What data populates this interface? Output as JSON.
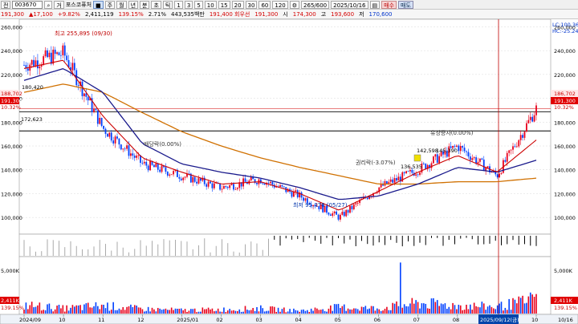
{
  "toolbar": {
    "code": "003670",
    "market_prefix": "전",
    "name_prefix": "거",
    "stock_name": "포스코퓨처",
    "period_buttons": [
      "주",
      "월",
      "년",
      "분",
      "초",
      "틱",
      "1",
      "3",
      "5",
      "10",
      "15",
      "20",
      "30",
      "60",
      "120"
    ],
    "range": "265/600",
    "date": "2025/10/16",
    "buy_label": "매수",
    "sell_label": "매도"
  },
  "quote": {
    "price": "191,300",
    "change": "17,100",
    "change_pct": "+9.82%",
    "volume": "2,411,119",
    "volume_ratio": "139.15%",
    "turnover": "2.71%",
    "amount": "443,535백만",
    "open_label": "시",
    "high_label": "고",
    "low_label": "저",
    "open_prefix_label": "191,400 회우선",
    "open": "191,300",
    "high": "174,300",
    "low_label_val": "193,600",
    "low": "170,600"
  },
  "price_axis": {
    "left_ticks": [
      "260,000",
      "240,000",
      "220,000",
      "200,000",
      "180,000",
      "160,000",
      "140,000",
      "120,000",
      "100,000"
    ],
    "right_ticks": [
      "260,000",
      "240,000",
      "220,000",
      "200,000",
      "180,000",
      "160,000",
      "140,000",
      "120,000",
      "100,000"
    ],
    "left_labels": {
      "current": "191,300",
      "pct": "10.32%",
      "hline1": "188,702",
      "hline2": "172,623"
    },
    "right_labels": {
      "current": "191,300",
      "pct": "10.32%",
      "hline1": "186,702",
      "lc": "LC:100.36",
      "hc": "HC:-25.24"
    }
  },
  "annotations": {
    "high": "최고 255,895 (09/30)",
    "low": "최저 95,476 (05/27)",
    "ex_rights": "권리락(-3.07%)",
    "rights_issue": "유상증자(0.00%)",
    "ex_div": "배당락(0.00%)",
    "price_a": "136,535",
    "price_b": "142,598",
    "price_c": "180,420",
    "price_d": "145,390"
  },
  "volume_axis": {
    "left_ticks": [
      "5,000K"
    ],
    "right_ticks": [
      "5,000K"
    ],
    "left_labels": {
      "current": "2,411K",
      "pct": "139.15%"
    },
    "right_labels": {
      "current": "2,411K",
      "pct": "139.15%"
    }
  },
  "date_axis": {
    "labels": [
      "2024/09",
      "10",
      "11",
      "12",
      "2025/01",
      "02",
      "03",
      "04",
      "05",
      "06",
      "07",
      "08",
      "09",
      "10"
    ],
    "cursor_label": "2025/09/12(금)",
    "right_label": "10/16"
  },
  "chart_data": {
    "type": "candlestick",
    "x": [
      "2024/09",
      "2024/10",
      "2024/11",
      "2024/12",
      "2025/01",
      "2025/02",
      "2025/03",
      "2025/04",
      "2025/05",
      "2025/06",
      "2025/07",
      "2025/08",
      "2025/09",
      "2025/10"
    ],
    "close": [
      228000,
      238000,
      175000,
      145000,
      135000,
      125000,
      132000,
      118000,
      100000,
      125000,
      140000,
      160000,
      135000,
      191300
    ],
    "ma_short": [
      225000,
      232000,
      185000,
      150000,
      138000,
      128000,
      130000,
      120000,
      106000,
      122000,
      138000,
      152000,
      138000,
      165000
    ],
    "ma_mid": [
      215000,
      225000,
      205000,
      162000,
      145000,
      138000,
      133000,
      125000,
      115000,
      118000,
      128000,
      142000,
      138000,
      148000
    ],
    "ma_long": [
      205000,
      212000,
      205000,
      188000,
      172000,
      160000,
      150000,
      142000,
      135000,
      128000,
      128000,
      130000,
      130000,
      133000
    ],
    "volume": [
      1500,
      900,
      1400,
      800,
      600,
      700,
      900,
      500,
      1100,
      900,
      1800,
      1400,
      1200,
      2411
    ],
    "ylim": [
      90000,
      265000
    ],
    "hlines": [
      188702,
      172623
    ],
    "colors": {
      "up": "#e8001c",
      "down": "#0040ff",
      "ma_short": "#cc0000",
      "ma_mid": "#1a1a8c",
      "ma_long": "#d07000"
    }
  }
}
